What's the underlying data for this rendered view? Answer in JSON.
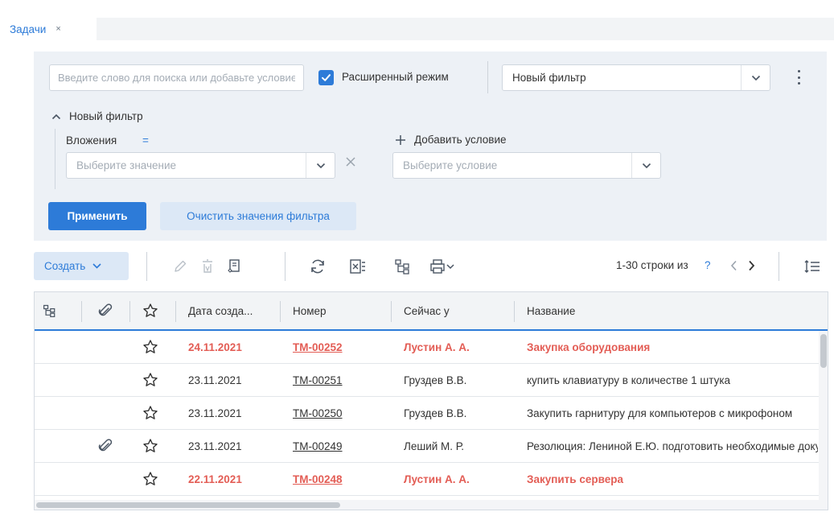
{
  "tabs": [
    {
      "label": "Задачи",
      "close": "×"
    }
  ],
  "filter": {
    "search_placeholder": "Введите слово для поиска или добавьте условие",
    "extended_mode_label": "Расширенный режим",
    "extended_mode_checked": true,
    "selected_filter": "Новый фильтр",
    "group_title": "Новый фильтр",
    "condition": {
      "field": "Вложения",
      "operator": "=",
      "value_placeholder": "Выберите значение"
    },
    "add_condition_label": "Добавить условие",
    "add_condition_placeholder": "Выберите условие",
    "apply_label": "Применить",
    "clear_label": "Очистить значения фильтра"
  },
  "toolbar": {
    "create_label": "Создать",
    "pager_text": "1-30 строки из",
    "pager_unknown": "?"
  },
  "table": {
    "columns": [
      "Дата созда...",
      "Номер",
      "Сейчас у",
      "Название"
    ],
    "rows": [
      {
        "date": "24.11.2021",
        "number": "ТМ-00252",
        "assignee": "Лустин А. А.",
        "title": "Закупка оборудования",
        "urgent": true,
        "attachment": false
      },
      {
        "date": "23.11.2021",
        "number": "ТМ-00251",
        "assignee": "Груздев В.В.",
        "title": "купить клавиатуру в количестве 1 штука",
        "urgent": false,
        "attachment": false
      },
      {
        "date": "23.11.2021",
        "number": "ТМ-00250",
        "assignee": "Груздев В.В.",
        "title": "Закупить гарнитуру для компьютеров с микрофоном",
        "urgent": false,
        "attachment": false
      },
      {
        "date": "23.11.2021",
        "number": "ТМ-00249",
        "assignee": "Леший М. Р.",
        "title": "Резолюция: Лениной Е.Ю. подготовить необходимые документы",
        "urgent": false,
        "attachment": true
      },
      {
        "date": "22.11.2021",
        "number": "ТМ-00248",
        "assignee": "Лустин А. А.",
        "title": "Закупить сервера",
        "urgent": true,
        "attachment": false
      }
    ]
  },
  "colors": {
    "accent": "#2d7bd8",
    "urgent": "#e35d55",
    "panel": "#edf1f6"
  },
  "icons": [
    "close-icon",
    "check-icon",
    "chevron-down-icon",
    "more-vertical-icon",
    "chevron-up-icon",
    "plus-icon",
    "x-icon",
    "edit-icon",
    "delete-icon",
    "document-icon",
    "refresh-icon",
    "excel-icon",
    "hierarchy-icon",
    "print-icon",
    "chevron-left-icon",
    "chevron-right-icon",
    "row-height-icon",
    "attachment-icon",
    "star-icon"
  ]
}
